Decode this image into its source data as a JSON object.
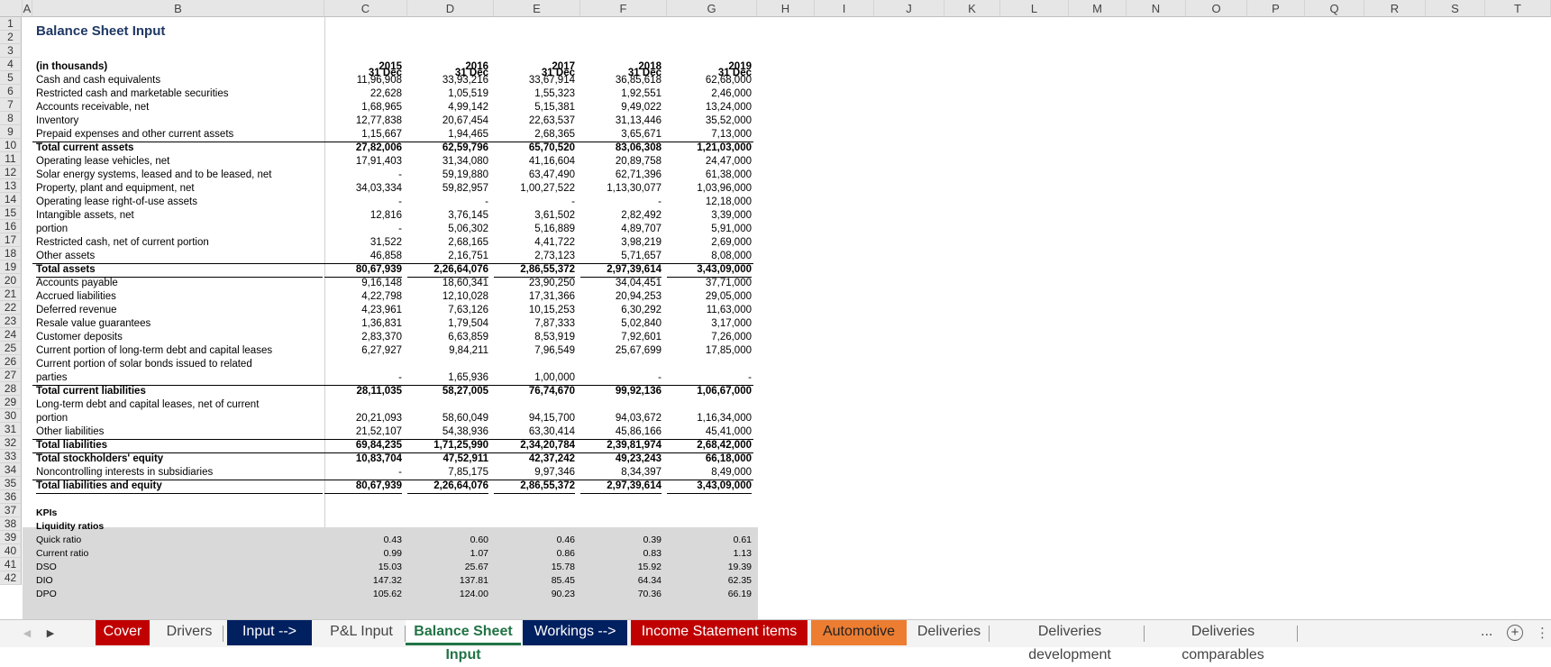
{
  "columns": [
    "A",
    "B",
    "C",
    "D",
    "E",
    "F",
    "G",
    "H",
    "I",
    "J",
    "K",
    "L",
    "M",
    "N",
    "O",
    "P",
    "Q",
    "R",
    "S",
    "T"
  ],
  "rows": [
    "1",
    "2",
    "3",
    "4",
    "5",
    "6",
    "7",
    "8",
    "9",
    "10",
    "11",
    "12",
    "13",
    "14",
    "15",
    "16",
    "17",
    "18",
    "19",
    "20",
    "21",
    "22",
    "23",
    "24",
    "25",
    "26",
    "27",
    "28",
    "29",
    "30",
    "31",
    "32",
    "33",
    "34",
    "35",
    "36",
    "37",
    "38",
    "39",
    "40",
    "41",
    "42"
  ],
  "sheet": {
    "title": "Balance Sheet Input",
    "headers": [
      {
        "line1": "31 Dec",
        "line2": "2015"
      },
      {
        "line1": "31 Dec",
        "line2": "2016"
      },
      {
        "line1": "31 Dec",
        "line2": "2017"
      },
      {
        "line1": "31 Dec",
        "line2": "2018"
      },
      {
        "line1": "31 Dec",
        "line2": "2019"
      }
    ],
    "units_label": "(in thousands)",
    "lines": [
      {
        "row": 4,
        "label": "Cash and cash equivalents",
        "values": [
          "11,96,908",
          "33,93,216",
          "33,67,914",
          "36,85,618",
          "62,68,000"
        ]
      },
      {
        "row": 5,
        "label": "Restricted cash and marketable securities",
        "values": [
          "22,628",
          "1,05,519",
          "1,55,323",
          "1,92,551",
          "2,46,000"
        ]
      },
      {
        "row": 6,
        "label": "Accounts receivable, net",
        "values": [
          "1,68,965",
          "4,99,142",
          "5,15,381",
          "9,49,022",
          "13,24,000"
        ]
      },
      {
        "row": 7,
        "label": "Inventory",
        "values": [
          "12,77,838",
          "20,67,454",
          "22,63,537",
          "31,13,446",
          "35,52,000"
        ]
      },
      {
        "row": 8,
        "label": "Prepaid expenses and other current assets",
        "values": [
          "1,15,667",
          "1,94,465",
          "2,68,365",
          "3,65,671",
          "7,13,000"
        ],
        "underline": true
      },
      {
        "row": 9,
        "label": "Total current assets",
        "values": [
          "27,82,006",
          "62,59,796",
          "65,70,520",
          "83,06,308",
          "1,21,03,000"
        ],
        "bold": true
      },
      {
        "row": 10,
        "label": "Operating lease vehicles, net",
        "values": [
          "17,91,403",
          "31,34,080",
          "41,16,604",
          "20,89,758",
          "24,47,000"
        ]
      },
      {
        "row": 11,
        "label": "Solar energy systems, leased and to be leased, net",
        "values": [
          "-",
          "59,19,880",
          "63,47,490",
          "62,71,396",
          "61,38,000"
        ]
      },
      {
        "row": 12,
        "label": "Property, plant and equipment, net",
        "values": [
          "34,03,334",
          "59,82,957",
          "1,00,27,522",
          "1,13,30,077",
          "1,03,96,000"
        ]
      },
      {
        "row": 13,
        "label": "Operating lease right-of-use assets",
        "values": [
          "-",
          "-",
          "-",
          "-",
          "12,18,000"
        ]
      },
      {
        "row": 14,
        "label": "Intangible assets, net",
        "values": [
          "12,816",
          "3,76,145",
          "3,61,502",
          "2,82,492",
          "3,39,000"
        ]
      },
      {
        "row": 15,
        "label": "portion",
        "values": [
          "-",
          "5,06,302",
          "5,16,889",
          "4,89,707",
          "5,91,000"
        ]
      },
      {
        "row": 16,
        "label": "Restricted cash, net of current portion",
        "values": [
          "31,522",
          "2,68,165",
          "4,41,722",
          "3,98,219",
          "2,69,000"
        ]
      },
      {
        "row": 17,
        "label": "Other assets",
        "values": [
          "46,858",
          "2,16,751",
          "2,73,123",
          "5,71,657",
          "8,08,000"
        ],
        "underline": true
      },
      {
        "row": 18,
        "label": "Total assets",
        "values": [
          "80,67,939",
          "2,26,64,076",
          "2,86,55,372",
          "2,97,39,614",
          "3,43,09,000"
        ],
        "bold": true,
        "underline": true
      },
      {
        "row": 19,
        "label": "Accounts payable",
        "values": [
          "9,16,148",
          "18,60,341",
          "23,90,250",
          "34,04,451",
          "37,71,000"
        ]
      },
      {
        "row": 20,
        "label": "Accrued liabilities",
        "values": [
          "4,22,798",
          "12,10,028",
          "17,31,366",
          "20,94,253",
          "29,05,000"
        ]
      },
      {
        "row": 21,
        "label": "Deferred revenue",
        "values": [
          "4,23,961",
          "7,63,126",
          "10,15,253",
          "6,30,292",
          "11,63,000"
        ]
      },
      {
        "row": 22,
        "label": "Resale value guarantees",
        "values": [
          "1,36,831",
          "1,79,504",
          "7,87,333",
          "5,02,840",
          "3,17,000"
        ]
      },
      {
        "row": 23,
        "label": "Customer deposits",
        "values": [
          "2,83,370",
          "6,63,859",
          "8,53,919",
          "7,92,601",
          "7,26,000"
        ]
      },
      {
        "row": 24,
        "label": "Current portion of long-term debt and capital leases",
        "values": [
          "6,27,927",
          "9,84,211",
          "7,96,549",
          "25,67,699",
          "17,85,000"
        ]
      },
      {
        "row": 25,
        "label": "Current portion of solar bonds issued to related",
        "values": [
          "",
          "",
          "",
          "",
          ""
        ]
      },
      {
        "row": 26,
        "label": "parties",
        "values": [
          "-",
          "1,65,936",
          "1,00,000",
          "-",
          "-"
        ],
        "underline": true
      },
      {
        "row": 27,
        "label": "Total current liabilities",
        "values": [
          "28,11,035",
          "58,27,005",
          "76,74,670",
          "99,92,136",
          "1,06,67,000"
        ],
        "bold": true
      },
      {
        "row": 28,
        "label": "Long-term debt and capital leases, net of current",
        "values": [
          "",
          "",
          "",
          "",
          ""
        ]
      },
      {
        "row": 29,
        "label": "portion",
        "values": [
          "20,21,093",
          "58,60,049",
          "94,15,700",
          "94,03,672",
          "1,16,34,000"
        ]
      },
      {
        "row": 30,
        "label": "Other liabilities",
        "values": [
          "21,52,107",
          "54,38,936",
          "63,30,414",
          "45,86,166",
          "45,41,000"
        ]
      },
      {
        "row": 31,
        "label": "Total liabilities",
        "values": [
          "69,84,235",
          "1,71,25,990",
          "2,34,20,784",
          "2,39,81,974",
          "2,68,42,000"
        ],
        "bold": true
      },
      {
        "row": 32,
        "label": "Total stockholders' equity",
        "values": [
          "10,83,704",
          "47,52,911",
          "42,37,242",
          "49,23,243",
          "66,18,000"
        ],
        "bold": true
      },
      {
        "row": 33,
        "label": "Noncontrolling interests in subsidiaries",
        "values": [
          "-",
          "7,85,175",
          "9,97,346",
          "8,34,397",
          "8,49,000"
        ],
        "underline": true
      },
      {
        "row": 34,
        "label": "Total liabilities and equity",
        "values": [
          "80,67,939",
          "2,26,64,076",
          "2,86,55,372",
          "2,97,39,614",
          "3,43,09,000"
        ],
        "bold": true,
        "underline": true
      }
    ],
    "kpi_title": "KPIs",
    "kpi_subtitle": "Liquidity ratios",
    "kpis": [
      {
        "row": 38,
        "label": "Quick ratio",
        "values": [
          "0.43",
          "0.60",
          "0.46",
          "0.39",
          "0.61"
        ]
      },
      {
        "row": 39,
        "label": "Current ratio",
        "values": [
          "0.99",
          "1.07",
          "0.86",
          "0.83",
          "1.13"
        ]
      },
      {
        "row": 40,
        "label": "DSO",
        "values": [
          "15.03",
          "25.67",
          "15.78",
          "15.92",
          "19.39"
        ]
      },
      {
        "row": 41,
        "label": "DIO",
        "values": [
          "147.32",
          "137.81",
          "85.45",
          "64.34",
          "62.35"
        ]
      },
      {
        "row": 42,
        "label": "DPO",
        "values": [
          "105.62",
          "124.00",
          "90.23",
          "70.36",
          "66.19"
        ]
      }
    ]
  },
  "tabs": [
    {
      "label": "Cover",
      "bg": "#c00000",
      "fg": "#ffffff"
    },
    {
      "label": "Drivers",
      "bg": "",
      "fg": "#444444"
    },
    {
      "label": "Input -->",
      "bg": "#002060",
      "fg": "#ffffff"
    },
    {
      "label": "P&L Input",
      "bg": "",
      "fg": "#444444"
    },
    {
      "label": "Balance Sheet Input",
      "bg": "#ffffff",
      "fg": "#217346",
      "active": true
    },
    {
      "label": "Workings -->",
      "bg": "#002060",
      "fg": "#ffffff"
    },
    {
      "label": "Income Statement items",
      "bg": "#c00000",
      "fg": "#ffffff"
    },
    {
      "label": "Automotive",
      "bg": "#ed7d31",
      "fg": "#222222"
    },
    {
      "label": "Deliveries",
      "bg": "",
      "fg": "#444444"
    },
    {
      "label": "Deliveries development",
      "bg": "",
      "fg": "#444444"
    },
    {
      "label": "Deliveries comparables",
      "bg": "",
      "fg": "#444444"
    }
  ],
  "tab_controls": {
    "more": "...",
    "add": "+",
    "options": "⋮"
  }
}
